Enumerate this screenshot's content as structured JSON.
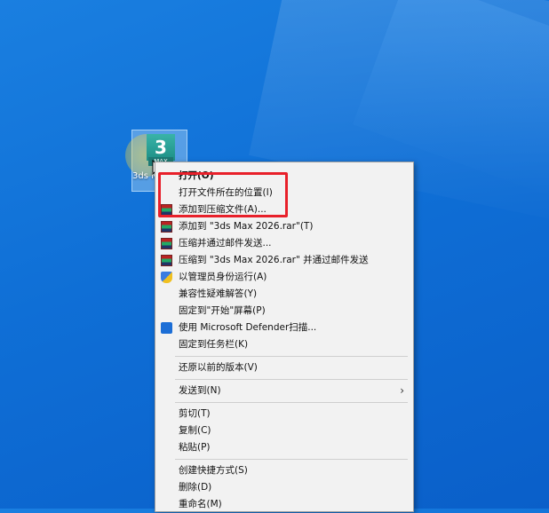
{
  "desktop_icon": {
    "logo_text": "3",
    "logo_sub": "MAX",
    "label": "3ds Max 2026"
  },
  "context_menu": {
    "groups": [
      [
        {
          "label": "打开(O)",
          "icon": "none",
          "bold": true
        },
        {
          "label": "打开文件所在的位置(I)",
          "icon": "none"
        },
        {
          "label": "添加到压缩文件(A)...",
          "icon": "rar-icon"
        },
        {
          "label": "添加到 \"3ds Max 2026.rar\"(T)",
          "icon": "rar-icon"
        },
        {
          "label": "压缩并通过邮件发送...",
          "icon": "rar-icon"
        },
        {
          "label": "压缩到 \"3ds Max 2026.rar\" 并通过邮件发送",
          "icon": "rar-icon"
        },
        {
          "label": "以管理员身份运行(A)",
          "icon": "uac-shield-icon"
        },
        {
          "label": "兼容性疑难解答(Y)",
          "icon": "none"
        },
        {
          "label": "固定到\"开始\"屏幕(P)",
          "icon": "none"
        },
        {
          "label": "使用 Microsoft Defender扫描...",
          "icon": "defender-icon"
        },
        {
          "label": "固定到任务栏(K)",
          "icon": "none"
        }
      ],
      [
        {
          "label": "还原以前的版本(V)",
          "icon": "none"
        }
      ],
      [
        {
          "label": "发送到(N)",
          "icon": "none",
          "submenu": true
        }
      ],
      [
        {
          "label": "剪切(T)",
          "icon": "none"
        },
        {
          "label": "复制(C)",
          "icon": "none"
        },
        {
          "label": "粘贴(P)",
          "icon": "none"
        }
      ],
      [
        {
          "label": "创建快捷方式(S)",
          "icon": "none"
        },
        {
          "label": "删除(D)",
          "icon": "none"
        },
        {
          "label": "重命名(M)",
          "icon": "none"
        }
      ]
    ]
  },
  "colors": {
    "highlight_border": "#e8202a",
    "menu_background": "#f2f2f2",
    "desktop_blue": "#0f6fd6"
  }
}
